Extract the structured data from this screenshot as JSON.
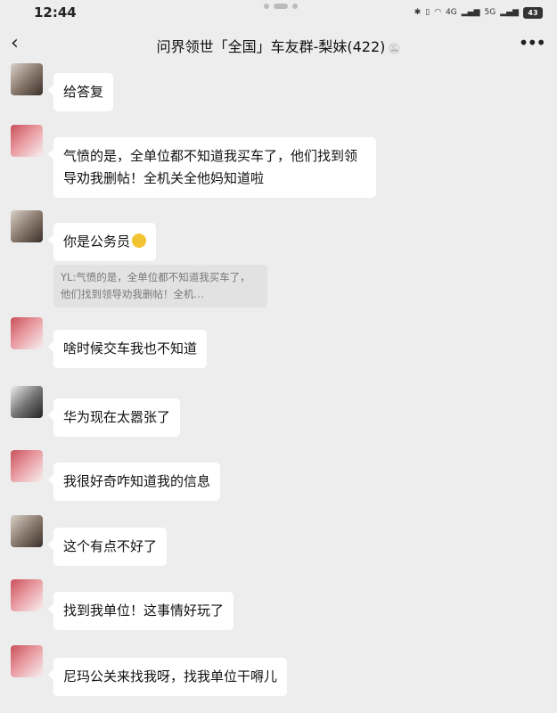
{
  "status_bar": {
    "time": "12:44",
    "icons": [
      "bluetooth-icon",
      "vibrate-icon",
      "wifi-icon",
      "signal-4g-icon",
      "signal-5g-icon"
    ],
    "network_labels": [
      "4G",
      "5G"
    ],
    "battery": "43"
  },
  "header": {
    "title": "问界领世「全国」车友群-梨妹(422)",
    "mute_icon": "mute-bell-icon",
    "back_icon": "chevron-left-icon",
    "more_icon": "more-dots-icon"
  },
  "messages": [
    {
      "avatar": "photo",
      "text": "给答复"
    },
    {
      "avatar": "red",
      "text": "气愤的是，全单位都不知道我买车了，他们找到领导劝我删帖！全机关全他妈知道啦"
    },
    {
      "avatar": "photo",
      "text": "你是公务员",
      "emoji": "laughing-face",
      "quote": "YL:气愤的是，全单位都不知道我买车了，他们找到领导劝我删帖！全机…"
    },
    {
      "avatar": "red",
      "text": "啥时候交车我也不知道"
    },
    {
      "avatar": "bw",
      "text": "华为现在太嚣张了"
    },
    {
      "avatar": "red",
      "text": "我很好奇咋知道我的信息"
    },
    {
      "avatar": "photo",
      "text": "这个有点不好了"
    },
    {
      "avatar": "red",
      "text": "找到我单位！这事情好玩了"
    },
    {
      "avatar": "red",
      "text": "尼玛公关来找我呀，找我单位干嘚儿"
    }
  ]
}
